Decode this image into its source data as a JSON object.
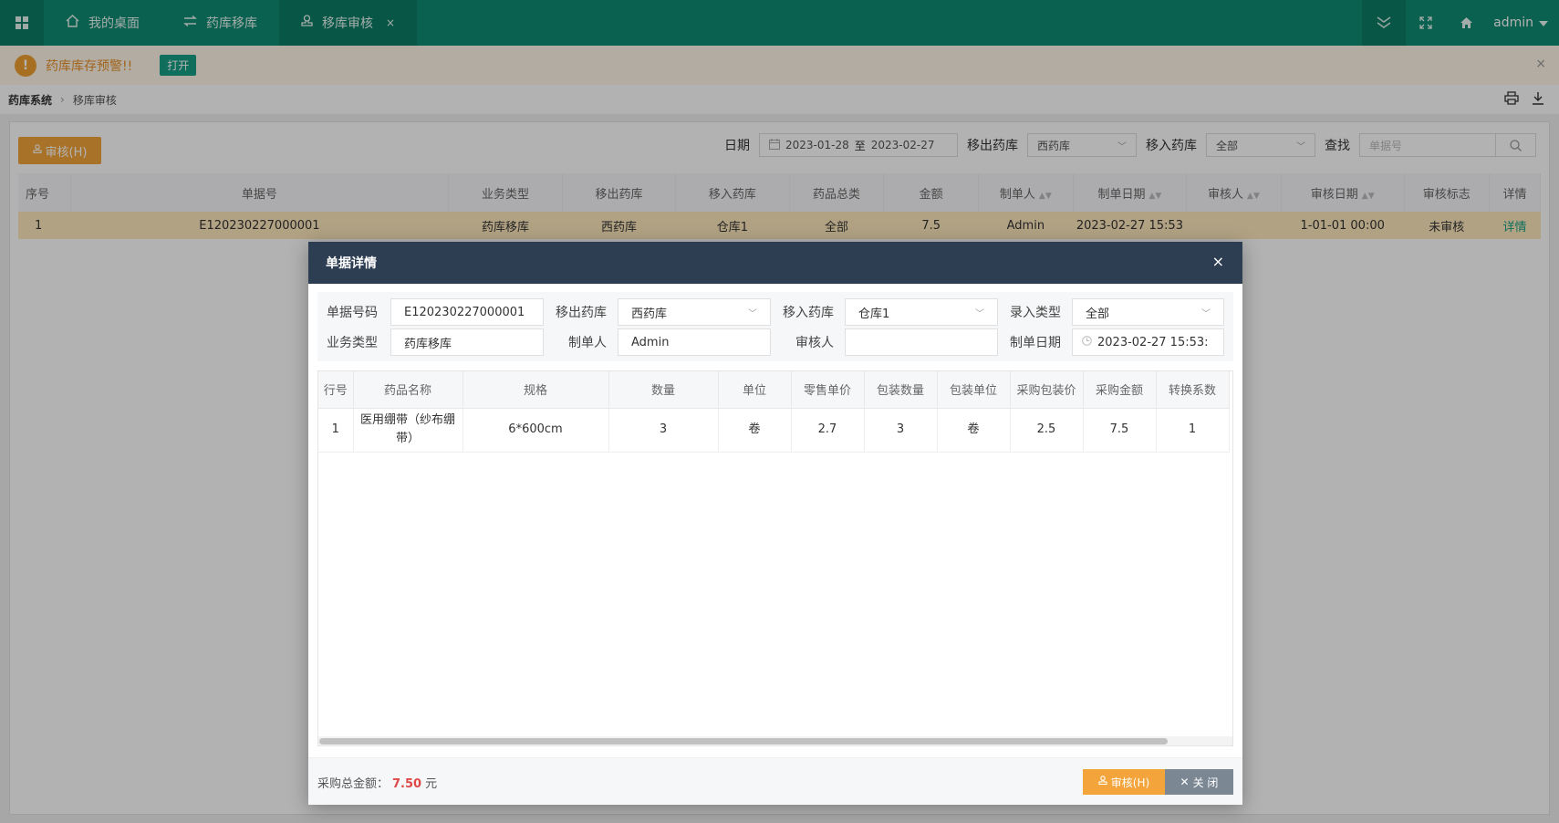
{
  "topbar": {
    "tabs": [
      {
        "label": "我的桌面",
        "icon": "home-icon"
      },
      {
        "label": "药库移库",
        "icon": "transfer-icon"
      },
      {
        "label": "移库审核",
        "icon": "stamp-icon",
        "close": "×"
      }
    ],
    "user": "admin"
  },
  "warning": {
    "icon_text": "!",
    "text": "药库库存预警!!",
    "open_label": "打开",
    "close": "×"
  },
  "breadcrumb": {
    "root": "药库系统",
    "current": "移库审核"
  },
  "toolbar": {
    "audit_label": "审核(H)",
    "date_label": "日期",
    "date_from": "2023-01-28",
    "date_to_sep": "至",
    "date_to": "2023-02-27",
    "out_label": "移出药库",
    "out_value": "西药库",
    "in_label": "移入药库",
    "in_value": "全部",
    "search_label": "查找",
    "search_placeholder": "单据号"
  },
  "main_table": {
    "headers": [
      "序号",
      "单据号",
      "业务类型",
      "移出药库",
      "移入药库",
      "药品总类",
      "金额",
      "制单人",
      "制单日期",
      "审核人",
      "审核日期",
      "审核标志",
      "详情"
    ],
    "rows": [
      [
        "1",
        "E120230227000001",
        "药库移库",
        "西药库",
        "仓库1",
        "全部",
        "7.5",
        "Admin",
        "2023-02-27 15:53",
        "",
        "1-01-01 00:00",
        "未审核",
        "详情"
      ]
    ]
  },
  "modal": {
    "title": "单据详情",
    "close": "×",
    "form": {
      "doc_no_label": "单据号码",
      "doc_no": "E120230227000001",
      "out_label": "移出药库",
      "out_value": "西药库",
      "in_label": "移入药库",
      "in_value": "仓库1",
      "entry_label": "录入类型",
      "entry_value": "全部",
      "biz_label": "业务类型",
      "biz_value": "药库移库",
      "maker_label": "制单人",
      "maker_value": "Admin",
      "auditor_label": "审核人",
      "auditor_value": "",
      "date_label": "制单日期",
      "date_value": "2023-02-27 15:53:"
    },
    "detail_table": {
      "headers": [
        "行号",
        "药品名称",
        "规格",
        "数量",
        "单位",
        "零售单价",
        "包装数量",
        "包装单位",
        "采购包装价",
        "采购金额",
        "转换系数"
      ],
      "rows": [
        [
          "1",
          "医用绷带（纱布绷带）",
          "6*600cm",
          "3",
          "卷",
          "2.7",
          "3",
          "卷",
          "2.5",
          "7.5",
          "1"
        ]
      ]
    },
    "footer": {
      "total_label": "采购总金额：",
      "total_amount": "7.50",
      "total_unit": "元",
      "ok_label": "审核(H)",
      "cancel_label": "关 闭"
    }
  }
}
